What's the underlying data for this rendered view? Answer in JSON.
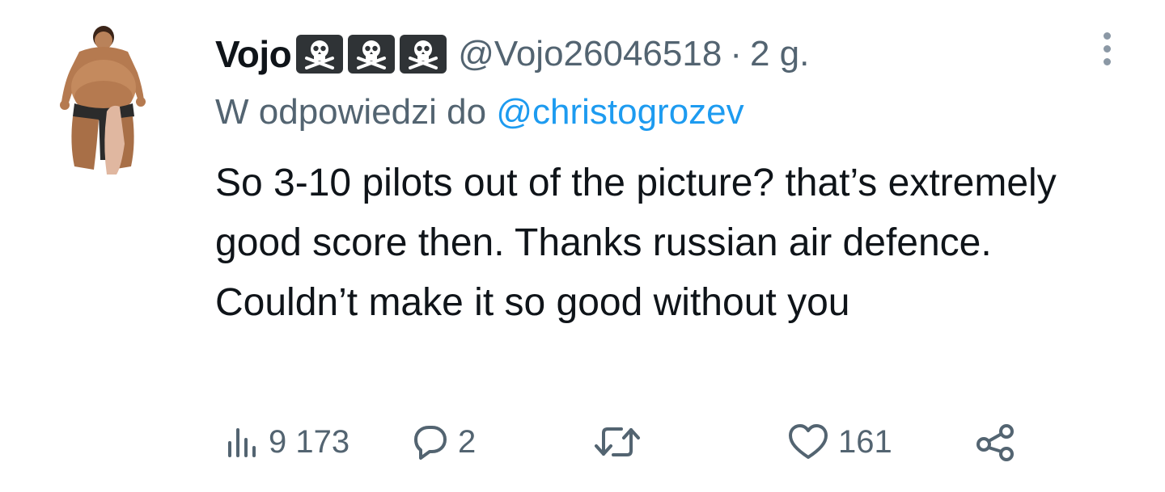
{
  "tweet": {
    "author_name": "Vojo",
    "badges": [
      "skull-crossbones-icon",
      "skull-crossbones-icon",
      "skull-crossbones-icon"
    ],
    "handle": "@Vojo26046518",
    "separator": "·",
    "time": "2 g.",
    "reply_prefix": "W odpowiedzi do",
    "reply_mention": "@christogrozev",
    "text": "So 3-10 pilots out of the picture? that’s extremely good score then. Thanks russian air defence. Couldn’t make it so good without you"
  },
  "actions": {
    "views_count": "9 173",
    "replies_count": "2",
    "retweets_count": "",
    "likes_count": "161"
  },
  "colors": {
    "text": "#0f1419",
    "secondary": "#536471",
    "link": "#1d9bf0",
    "badge_bg": "#2f3336"
  }
}
